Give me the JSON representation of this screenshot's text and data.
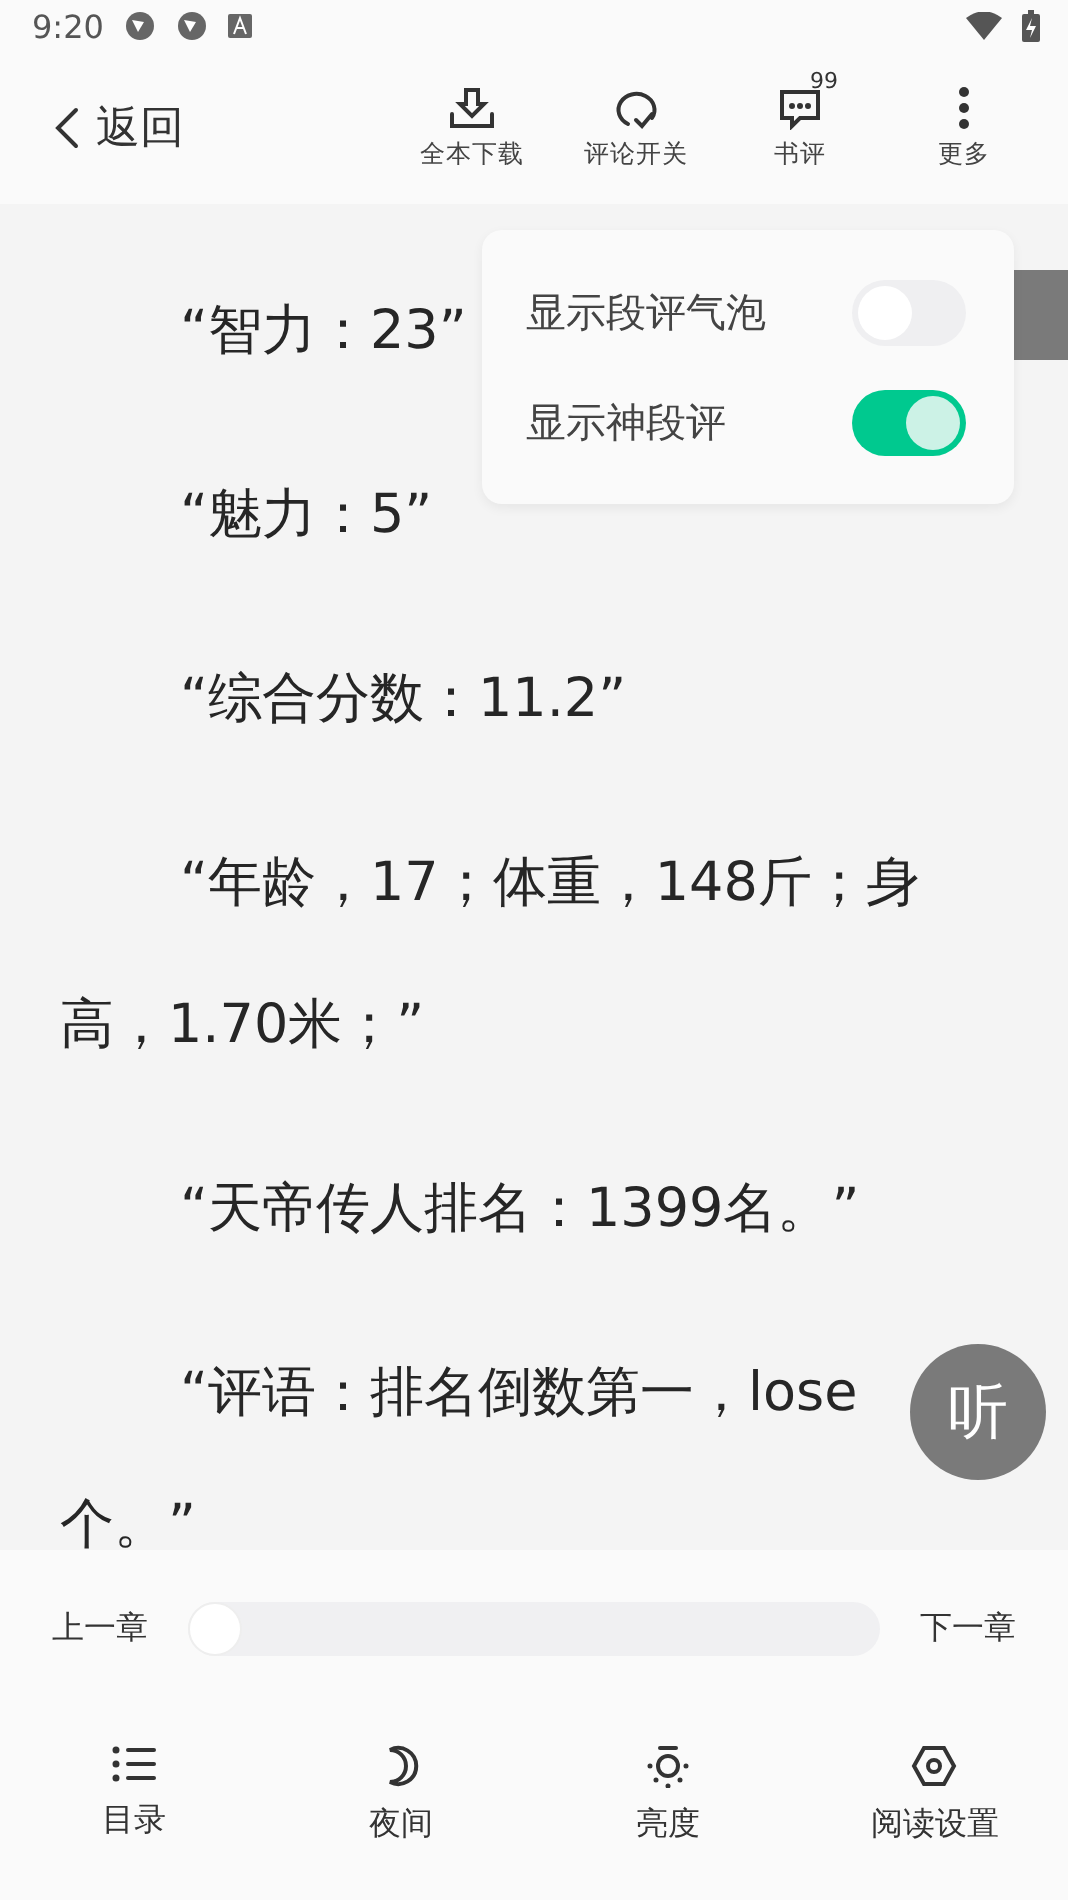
{
  "status_bar": {
    "time": "9:20"
  },
  "header": {
    "back": "返回",
    "actions": [
      {
        "kind": "download",
        "label": "全本下载"
      },
      {
        "kind": "comment",
        "label": "评论开关"
      },
      {
        "kind": "review",
        "label": "书评",
        "badge": "99"
      },
      {
        "kind": "more",
        "label": "更多"
      }
    ]
  },
  "popup": {
    "toggles": [
      {
        "label": "显示段评气泡",
        "on": false
      },
      {
        "label": "显示神段评",
        "on": true
      }
    ]
  },
  "content": {
    "paragraphs": [
      "“智力：23”",
      "“魅力：5”",
      "“综合分数：11.2”",
      "“年龄，17；体重，148斤；身高，1.70米；”",
      "“天帝传人排名：1399名。”",
      "“评语：排名倒数第一，lose",
      "个。”"
    ]
  },
  "listen_button": "听",
  "chapter_nav": {
    "prev": "上一章",
    "next": "下一章",
    "level": 0
  },
  "bottom_tabs": [
    {
      "kind": "list",
      "label": "目录"
    },
    {
      "kind": "night",
      "label": "夜间"
    },
    {
      "kind": "brightness",
      "label": "亮度"
    },
    {
      "kind": "settings",
      "label": "阅读设置"
    }
  ]
}
